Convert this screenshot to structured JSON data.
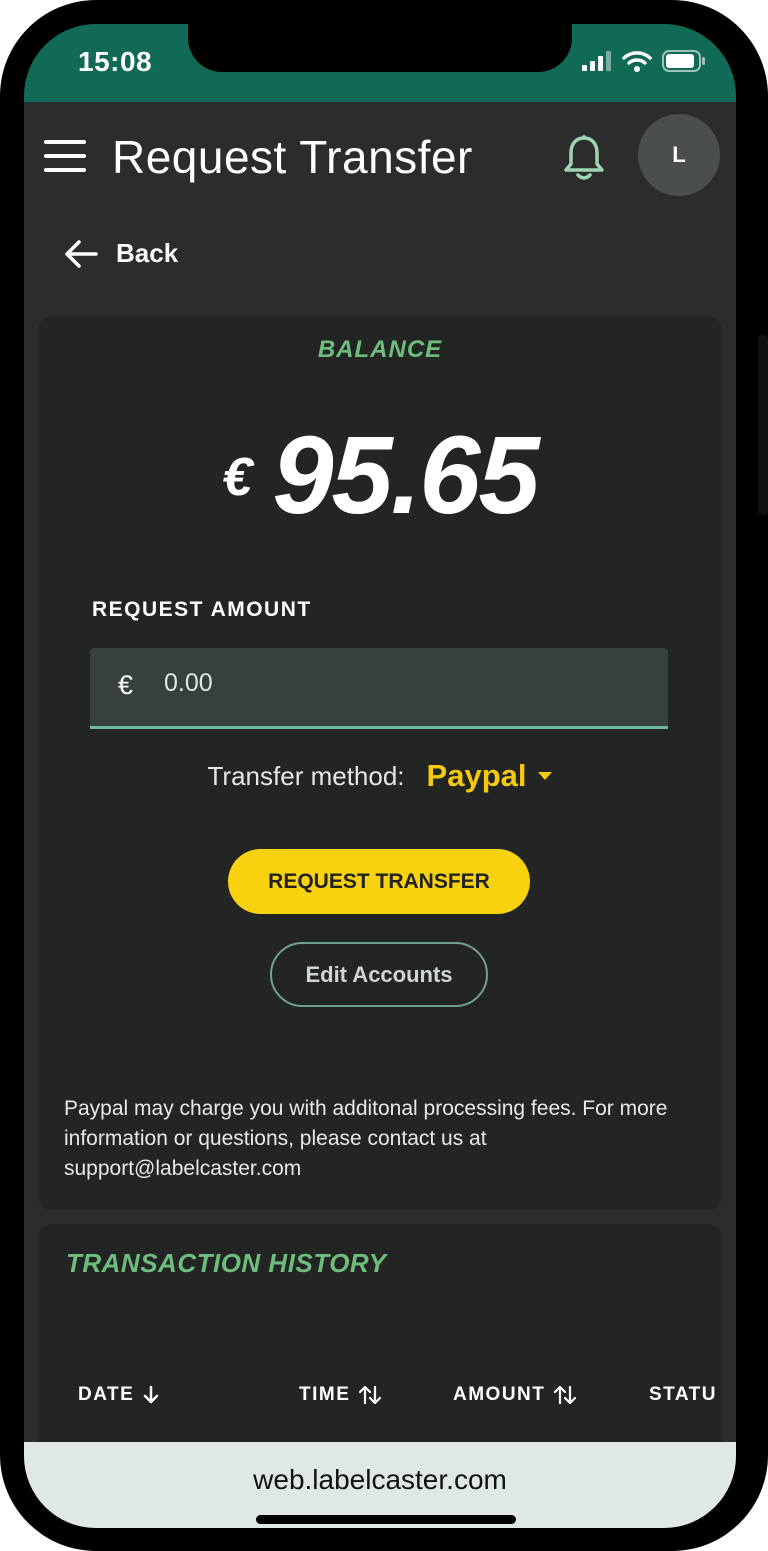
{
  "status_bar": {
    "time": "15:08"
  },
  "app_bar": {
    "title": "Request Transfer",
    "avatar_initial": "L"
  },
  "nav": {
    "back_label": "Back"
  },
  "balance": {
    "label": "BALANCE",
    "currency": "€",
    "amount": "95.65"
  },
  "request": {
    "label": "REQUEST AMOUNT",
    "currency": "€",
    "placeholder": "0.00",
    "method_label": "Transfer method:",
    "method_value": "Paypal",
    "submit_label": "REQUEST TRANSFER",
    "edit_label": "Edit Accounts",
    "note": "Paypal may charge you with additonal processing fees. For more information or questions, please contact us at support@labelcaster.com"
  },
  "history": {
    "title": "TRANSACTION HISTORY",
    "columns": [
      {
        "label": "DATE",
        "sort_icon": "arrow-down-icon"
      },
      {
        "label": "TIME",
        "sort_icon": "sort-up-down-icon"
      },
      {
        "label": "AMOUNT",
        "sort_icon": "sort-up-down-icon"
      },
      {
        "label": "STATU"
      }
    ]
  },
  "browser": {
    "url": "web.labelcaster.com"
  },
  "colors": {
    "status_bar": "#116a55",
    "accent_green": "#6dbe7c",
    "accent_yellow": "#f8d20e",
    "background": "#2a2d2b",
    "card": "#222523"
  },
  "icons": [
    "menu-icon",
    "bell-icon",
    "arrow-left-icon",
    "caret-down-icon",
    "cellular-icon",
    "wifi-icon",
    "battery-icon"
  ]
}
